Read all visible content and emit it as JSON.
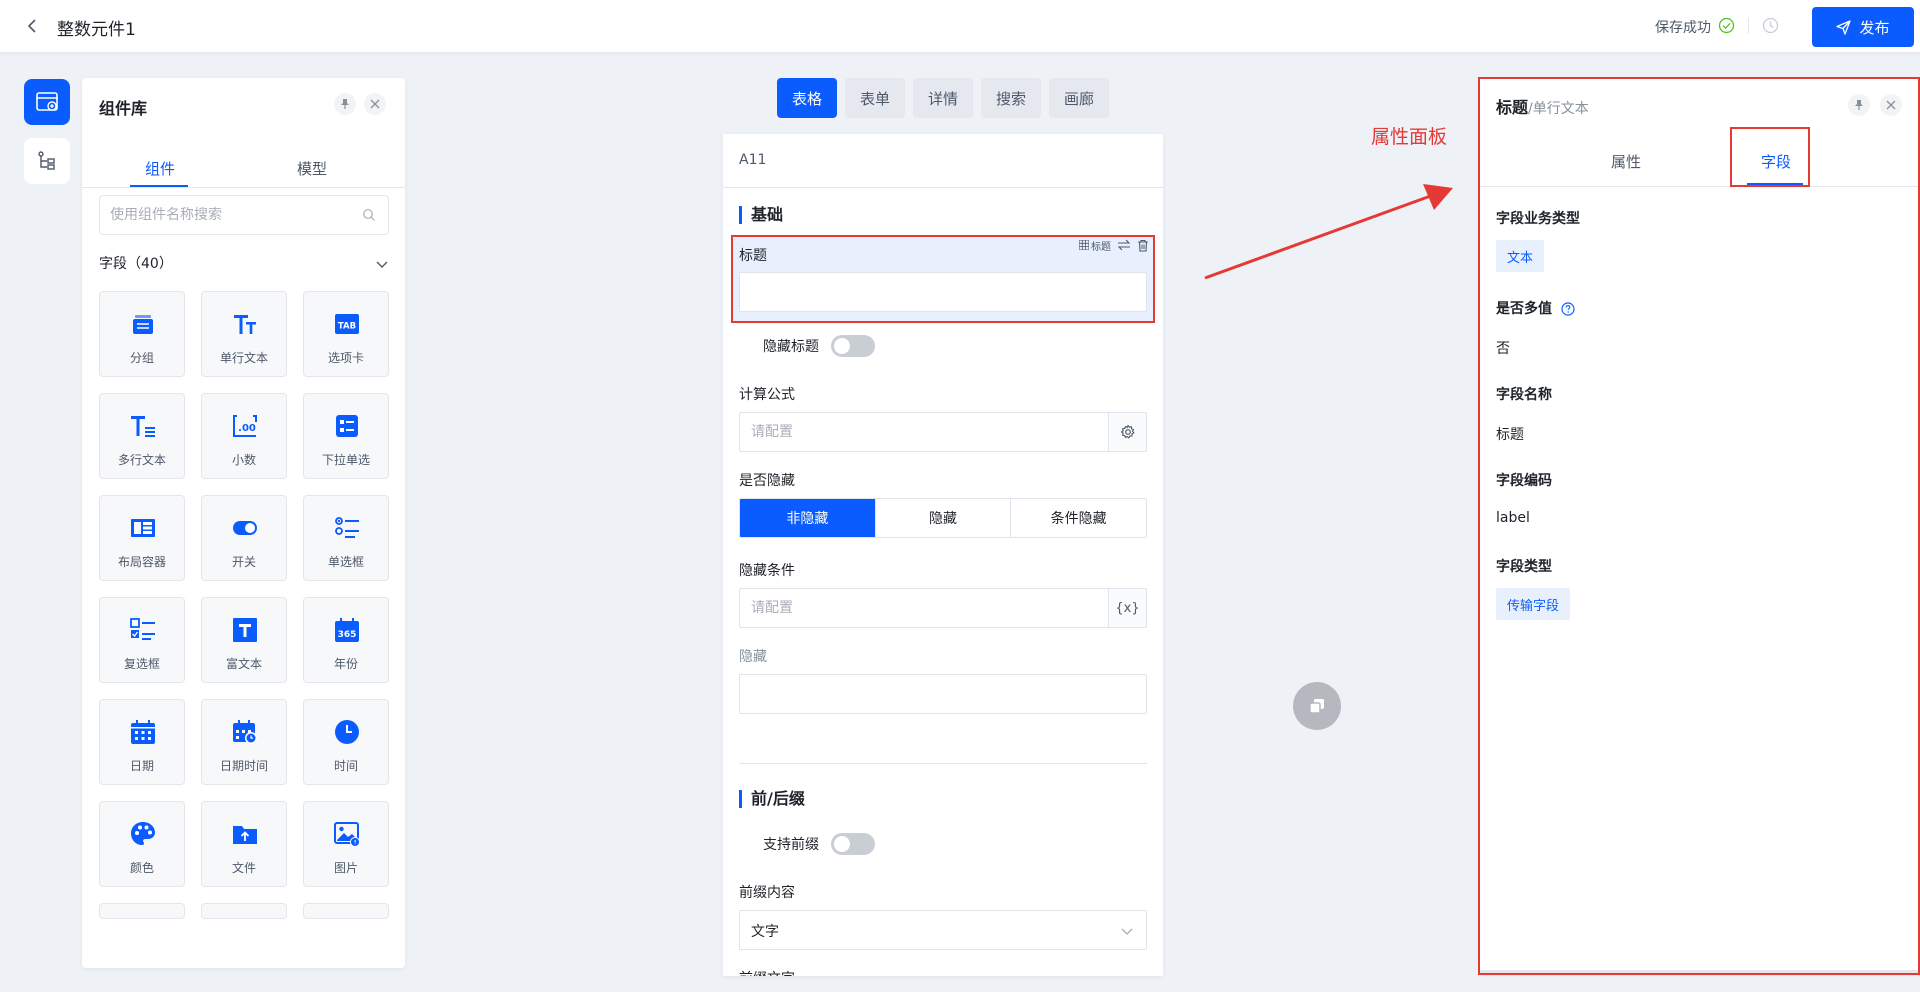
{
  "header": {
    "title": "整数元件1",
    "save_status": "保存成功",
    "publish_label": "发布"
  },
  "library": {
    "title": "组件库",
    "tabs": [
      "组件",
      "模型"
    ],
    "search_placeholder": "使用组件名称搜索",
    "group_label": "字段（40）",
    "components": [
      {
        "label": "分组",
        "icon": "group-icon"
      },
      {
        "label": "单行文本",
        "icon": "single-text-icon"
      },
      {
        "label": "选项卡",
        "icon": "tab-icon"
      },
      {
        "label": "多行文本",
        "icon": "multi-text-icon"
      },
      {
        "label": "小数",
        "icon": "decimal-icon"
      },
      {
        "label": "下拉单选",
        "icon": "dropdown-icon"
      },
      {
        "label": "布局容器",
        "icon": "layout-icon"
      },
      {
        "label": "开关",
        "icon": "switch-icon"
      },
      {
        "label": "单选框",
        "icon": "radio-icon"
      },
      {
        "label": "复选框",
        "icon": "checkbox-icon"
      },
      {
        "label": "富文本",
        "icon": "rich-text-icon"
      },
      {
        "label": "年份",
        "icon": "year-icon"
      },
      {
        "label": "日期",
        "icon": "date-icon"
      },
      {
        "label": "日期时间",
        "icon": "datetime-icon"
      },
      {
        "label": "时间",
        "icon": "time-icon"
      },
      {
        "label": "颜色",
        "icon": "color-icon"
      },
      {
        "label": "文件",
        "icon": "file-icon"
      },
      {
        "label": "图片",
        "icon": "image-icon"
      }
    ]
  },
  "view_tabs": [
    "表格",
    "表单",
    "详情",
    "搜索",
    "画廊"
  ],
  "canvas": {
    "header_text": "A11",
    "section_basic": "基础",
    "selected_field_label": "标题",
    "selected_field_tool_tag": "标题",
    "hide_title_label": "隐藏标题",
    "formula_label": "计算公式",
    "formula_placeholder": "请配置",
    "is_hidden_label": "是否隐藏",
    "hidden_options": [
      "非隐藏",
      "隐藏",
      "条件隐藏"
    ],
    "hidden_condition_label": "隐藏条件",
    "hidden_condition_placeholder": "请配置",
    "hidden_label": "隐藏",
    "section_affix": "前/后缀",
    "support_prefix_label": "支持前缀",
    "prefix_content_label": "前缀内容",
    "prefix_content_value": "文字",
    "prefix_text_label": "前缀文字",
    "expr_addon": "{x}"
  },
  "annotation": {
    "text": "属性面板"
  },
  "properties": {
    "title": "标题",
    "subtitle": "/单行文本",
    "tabs": [
      "属性",
      "字段"
    ],
    "business_type_label": "字段业务类型",
    "business_type_value": "文本",
    "multi_value_label": "是否多值",
    "multi_value_value": "否",
    "field_name_label": "字段名称",
    "field_name_value": "标题",
    "field_code_label": "字段编码",
    "field_code_value": "label",
    "field_type_label": "字段类型",
    "field_type_value": "传输字段"
  },
  "colors": {
    "primary": "#0b5cff",
    "annotation": "#e53935",
    "success": "#52c41a"
  }
}
